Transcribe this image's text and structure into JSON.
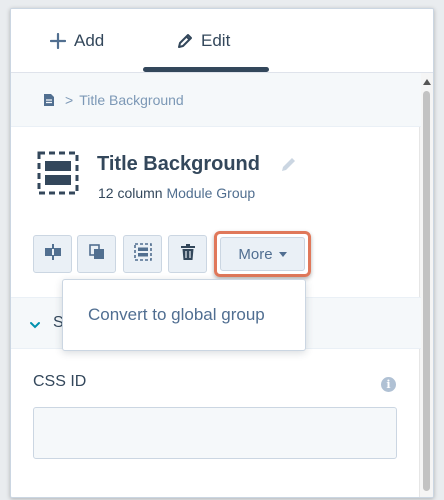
{
  "tabs": [
    {
      "label": "Add",
      "icon": "plus-icon"
    },
    {
      "label": "Edit",
      "icon": "pencil-icon",
      "active": true
    }
  ],
  "breadcrumb": {
    "icon": "document-icon",
    "separator": ">",
    "current": "Title Background"
  },
  "module": {
    "icon": "module-group-icon",
    "title": "Title Background",
    "subtitle_prefix": "12 column",
    "subtitle_link": "Module Group"
  },
  "actions": [
    {
      "icon": "split-column-icon"
    },
    {
      "icon": "clone-icon"
    },
    {
      "icon": "select-group-icon"
    },
    {
      "icon": "trash-icon"
    }
  ],
  "more_button": {
    "label": "More"
  },
  "dropdown": {
    "items": [
      "Convert to global group"
    ]
  },
  "section": {
    "label_visible": "S"
  },
  "css_id": {
    "label": "CSS ID",
    "value": "",
    "placeholder": ""
  },
  "colors": {
    "text": "#33475b",
    "muted": "#7c98b6",
    "button_bg": "#eaf0f6",
    "border": "#cbd6e2",
    "highlight": "#e0785a"
  }
}
